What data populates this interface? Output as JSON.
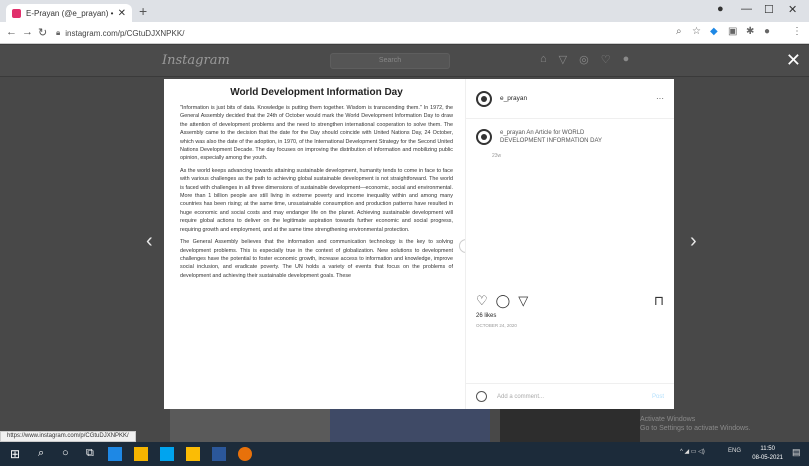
{
  "browser": {
    "tab_title": "E-Prayan (@e_prayan) • Instagr...",
    "tab_close": "✕",
    "new_tab": "+",
    "url": "instagram.com/p/CGtuDJXNPKK/",
    "status_url": "https://www.instagram.com/p/CGtuDJXNPKK/",
    "window_controls": [
      "—",
      "☐",
      "✕"
    ]
  },
  "instagram": {
    "logo": "Instagram",
    "search_placeholder": "Search",
    "close": "✕"
  },
  "article": {
    "title": "World Development Information Day",
    "paragraphs": [
      "\"Information is just bits of data. Knowledge is putting them together. Wisdom is transcending them.\" In 1972, the General Assembly decided that the 24th of October would mark the World Development Information Day to draw the attention of development problems and the need to strengthen international cooperation to solve them. The Assembly came to the decision that the date for the Day should coincide with United Nations Day, 24 October, which was also the date of the adoption, in 1970, of the International Development Strategy for the Second United Nations Development Decade. The day focuses on improving the distribution of information and mobilizing public opinion, especially among the youth.",
      "As the world keeps advancing towards attaining sustainable development, humanity tends to come in face to face with various challenges as the path to achieving global sustainable development is not straightforward. The world is faced with challenges in all three dimensions of sustainable development—economic, social and environmental. More than 1 billion people are still living in extreme poverty and income inequality within and among many countries has been rising; at the same time, unsustainable consumption and production patterns have resulted in huge economic and social costs and may endanger life on the planet. Achieving sustainable development will require global actions to deliver on the legitimate aspiration towards further economic and social progress, requiring growth and employment, and at the same time strengthening environmental protection.",
      "The General Assembly believes that the information and communication technology is the key to solving development problems. This is especially true in the context of globalization. New solutions to development challenges have the potential to foster economic growth, increase access to information and knowledge, improve social inclusion, and eradicate poverty. The UN holds a variety of events that focus on the problems of development and achieving their sustainable development goals. These"
    ]
  },
  "post": {
    "username": "e_prayan",
    "more": "···",
    "caption": "e_prayan An Article for WORLD DEVELOPMENT INFORMATION DAY",
    "caption_time": "23w",
    "likes": "26 likes",
    "date": "OCTOBER 24, 2020",
    "comment_placeholder": "Add a comment...",
    "post_button": "Post"
  },
  "desktop": {
    "watermark_title": "Activate Windows",
    "watermark_sub": "Go to Settings to activate Windows.",
    "tray_lang": "ENG",
    "time": "11:50",
    "date": "08-05-2021"
  }
}
